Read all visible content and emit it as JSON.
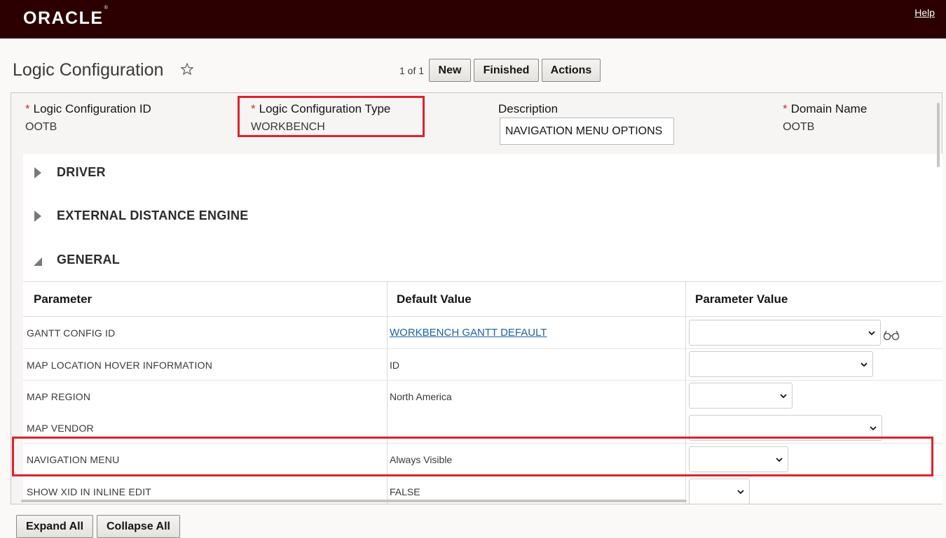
{
  "header": {
    "logo_text": "ORACLE",
    "logo_mark": "®",
    "help_label": "Help",
    "brand_color": "#2c0000"
  },
  "page": {
    "title": "Logic Configuration",
    "favorite_icon": "star-outline-icon",
    "pager_text": "1 of 1",
    "buttons": {
      "new": "New",
      "finished": "Finished",
      "actions": "Actions"
    }
  },
  "form": {
    "required_marker": "*",
    "id_label": "Logic Configuration ID",
    "id_value": "OOTB",
    "type_label": "Logic Configuration Type",
    "type_value": "WORKBENCH",
    "description_label": "Description",
    "description_value": "NAVIGATION MENU OPTIONS",
    "domain_label": "Domain Name",
    "domain_value": "OOTB"
  },
  "sections": [
    {
      "label": "DRIVER",
      "state": "collapsed"
    },
    {
      "label": "EXTERNAL DISTANCE ENGINE",
      "state": "collapsed"
    },
    {
      "label": "GENERAL",
      "state": "expanded"
    }
  ],
  "grid": {
    "columns": [
      "Parameter",
      "Default Value",
      "Parameter Value"
    ],
    "rows": [
      {
        "parameter": "GANTT CONFIG ID",
        "default": "WORKBENCH GANTT DEFAULT",
        "value": "",
        "default_is_link": true,
        "has_lov": true
      },
      {
        "parameter": "MAP LOCATION HOVER INFORMATION",
        "default": "ID",
        "value": ""
      },
      {
        "parameter": "MAP REGION",
        "default": "North America",
        "value": ""
      },
      {
        "parameter": "MAP VENDOR",
        "default": "",
        "value": ""
      },
      {
        "parameter": "NAVIGATION MENU",
        "default": "Always Visible",
        "value": ""
      },
      {
        "parameter": "SHOW XID IN INLINE EDIT",
        "default": "FALSE",
        "value": ""
      }
    ]
  },
  "footer": {
    "expand_all": "Expand All",
    "collapse_all": "Collapse All"
  },
  "highlight_color": "#e0212b"
}
